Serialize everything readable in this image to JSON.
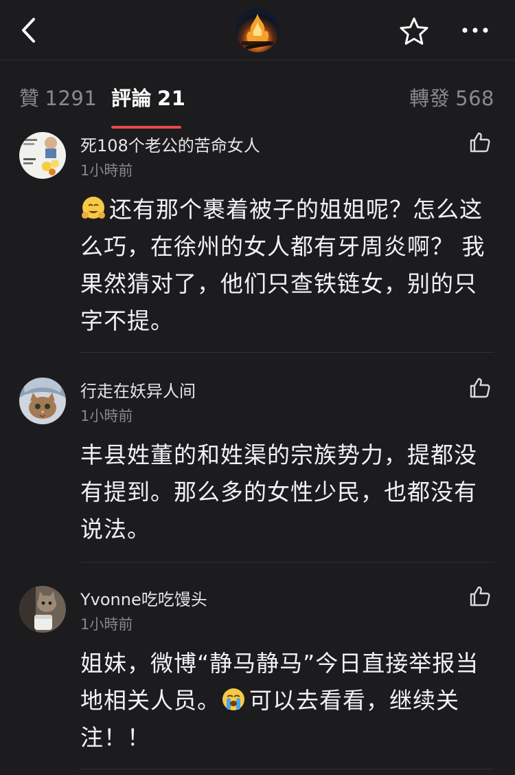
{
  "tabs": {
    "likes": {
      "label": "贊",
      "count": "1291"
    },
    "comments": {
      "label": "評論",
      "count": "21"
    },
    "reposts": {
      "label": "轉發",
      "count": "568"
    }
  },
  "comments": [
    {
      "name": "死108个老公的苦命女人",
      "time": "1小時前",
      "text": "还有那个裹着被子的姐姐呢？怎么这么巧，在徐州的女人都有牙周炎啊？ 我果然猜对了，他们只查铁链女，别的只字不提。",
      "leading_emoji": "hugging-face"
    },
    {
      "name": "行走在妖异人间",
      "time": "1小時前",
      "text": "丰县姓董的和姓渠的宗族势力，提都没有提到。那么多的女性少民，也都没有说法。"
    },
    {
      "name": "Yvonne吃吃馒头",
      "time": "1小時前",
      "text_before": "姐妹，微博“静马静马”今日直接举报当地相关人员。",
      "inline_emoji": "crying-face",
      "text_after": "可以去看看，继续关注！！"
    }
  ],
  "icons": {
    "back": "chevron-left-icon",
    "favorite": "star-outline-icon",
    "more": "more-dots-icon",
    "like": "thumbs-up-outline-icon"
  },
  "colors": {
    "background": "#1c1c1e",
    "accent": "#e8484d",
    "muted": "#88888d"
  }
}
